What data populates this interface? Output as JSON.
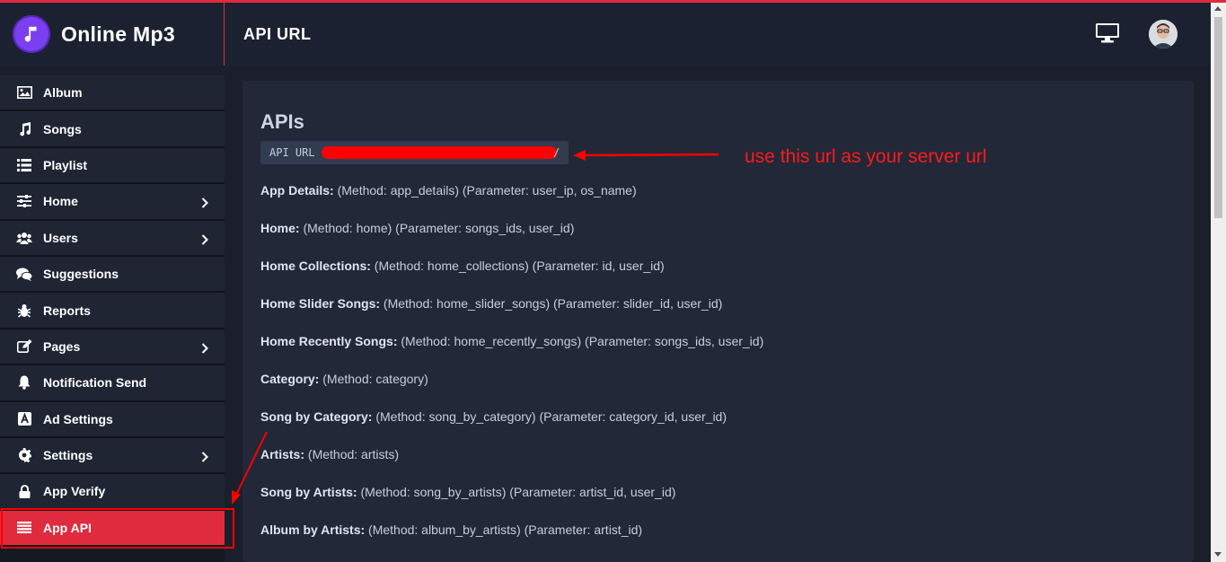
{
  "colors": {
    "accent": "#e02b3e",
    "annotation": "#ff0000"
  },
  "header": {
    "brand": "Online Mp3",
    "page_title": "API URL",
    "icons": [
      "music-note-icon",
      "monitor-icon",
      "avatar"
    ]
  },
  "sidebar": {
    "items": [
      {
        "label": "Album",
        "icon": "image-icon"
      },
      {
        "label": "Songs",
        "icon": "music-icon"
      },
      {
        "label": "Playlist",
        "icon": "list-icon"
      },
      {
        "label": "Home",
        "icon": "sliders-icon",
        "has_submenu": true
      },
      {
        "label": "Users",
        "icon": "users-icon",
        "has_submenu": true
      },
      {
        "label": "Suggestions",
        "icon": "comments-icon"
      },
      {
        "label": "Reports",
        "icon": "bug-icon"
      },
      {
        "label": "Pages",
        "icon": "edit-icon",
        "has_submenu": true
      },
      {
        "label": "Notification Send",
        "icon": "bell-icon"
      },
      {
        "label": "Ad Settings",
        "icon": "ad-icon"
      },
      {
        "label": "Settings",
        "icon": "gear-icon",
        "has_submenu": true
      },
      {
        "label": "App Verify",
        "icon": "lock-icon"
      },
      {
        "label": "App API",
        "icon": "bars-icon",
        "active": true
      }
    ]
  },
  "main": {
    "title": "APIs",
    "url_label": "API URL",
    "url_suffix": "/",
    "annotation": "use this url as your server url",
    "apis": [
      {
        "name": "App Details:",
        "detail": "(Method: app_details) (Parameter: user_ip, os_name)"
      },
      {
        "name": "Home:",
        "detail": "(Method: home) (Parameter: songs_ids, user_id)"
      },
      {
        "name": "Home Collections:",
        "detail": "(Method: home_collections) (Parameter: id, user_id)"
      },
      {
        "name": "Home Slider Songs:",
        "detail": "(Method: home_slider_songs) (Parameter: slider_id, user_id)"
      },
      {
        "name": "Home Recently Songs:",
        "detail": "(Method: home_recently_songs) (Parameter: songs_ids, user_id)"
      },
      {
        "name": "Category:",
        "detail": "(Method: category)"
      },
      {
        "name": "Song by Category:",
        "detail": "(Method: song_by_category) (Parameter: category_id, user_id)"
      },
      {
        "name": "Artists:",
        "detail": "(Method: artists)"
      },
      {
        "name": "Song by Artists:",
        "detail": "(Method: song_by_artists) (Parameter: artist_id, user_id)"
      },
      {
        "name": "Album by Artists:",
        "detail": "(Method: album_by_artists) (Parameter: artist_id)"
      }
    ]
  }
}
